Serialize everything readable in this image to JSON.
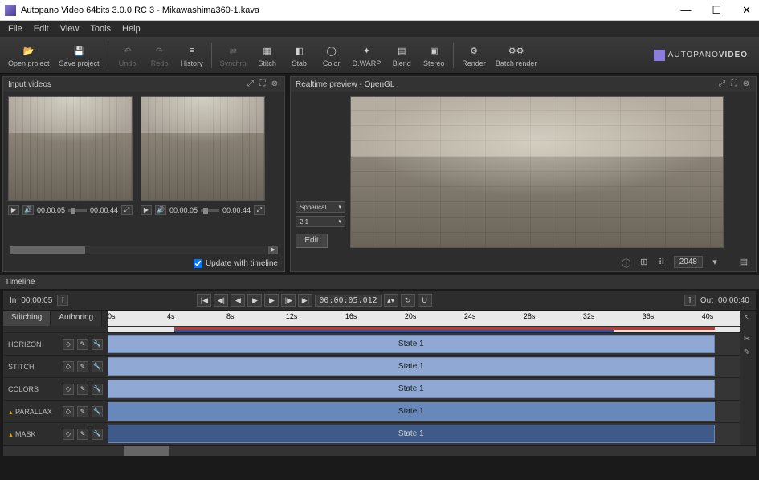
{
  "window": {
    "title": "Autopano Video 64bits 3.0.0 RC 3 - Mikawashima360-1.kava",
    "min": "—",
    "max": "☐",
    "close": "✕"
  },
  "menu": [
    "File",
    "Edit",
    "View",
    "Tools",
    "Help"
  ],
  "toolbar": [
    {
      "id": "open",
      "label": "Open project",
      "glyph": "📂"
    },
    {
      "id": "save",
      "label": "Save project",
      "glyph": "💾"
    },
    {
      "sep": true
    },
    {
      "id": "undo",
      "label": "Undo",
      "glyph": "↶",
      "dis": true
    },
    {
      "id": "redo",
      "label": "Redo",
      "glyph": "↷",
      "dis": true
    },
    {
      "id": "history",
      "label": "History",
      "glyph": "≡"
    },
    {
      "sep": true
    },
    {
      "id": "synchro",
      "label": "Synchro",
      "glyph": "⇄",
      "dis": true
    },
    {
      "id": "stitch",
      "label": "Stitch",
      "glyph": "▦"
    },
    {
      "id": "stab",
      "label": "Stab",
      "glyph": "◧"
    },
    {
      "id": "color",
      "label": "Color",
      "glyph": "◯"
    },
    {
      "id": "dwarp",
      "label": "D.WARP",
      "glyph": "✦"
    },
    {
      "id": "blend",
      "label": "Blend",
      "glyph": "▤"
    },
    {
      "id": "stereo",
      "label": "Stereo",
      "glyph": "▣"
    },
    {
      "sep": true
    },
    {
      "id": "render",
      "label": "Render",
      "glyph": "⚙"
    },
    {
      "id": "batch",
      "label": "Batch render",
      "glyph": "⚙⚙"
    }
  ],
  "brand": {
    "name": "AUTOPANO",
    "suffix": "VIDEO"
  },
  "panels": {
    "input": {
      "title": "Input videos"
    },
    "preview": {
      "title": "Realtime preview - OpenGL"
    }
  },
  "thumbs": [
    {
      "start": "00:00:05",
      "end": "00:00:44"
    },
    {
      "start": "00:00:05",
      "end": "00:00:44"
    }
  ],
  "input_foot": {
    "checkbox": "Update with timeline",
    "checked": true
  },
  "preview_side": {
    "proj": "Spherical",
    "ratio": "2:1",
    "edit": "Edit"
  },
  "preview_foot": {
    "width": "2048"
  },
  "timeline": {
    "title": "Timeline",
    "in_label": "In",
    "in_time": "00:00:05",
    "out_label": "Out",
    "out_time": "00:00:40",
    "timecode": "00:00:05.012",
    "tabs": [
      "Stitching",
      "Authoring"
    ],
    "active_tab": 0,
    "ticks": [
      "0s",
      "4s",
      "8s",
      "12s",
      "16s",
      "20s",
      "24s",
      "28s",
      "32s",
      "36s",
      "40s"
    ],
    "tracks": [
      {
        "name": "HORIZON",
        "state": "State 1",
        "style": "a"
      },
      {
        "name": "STITCH",
        "state": "State 1",
        "style": "a"
      },
      {
        "name": "COLORS",
        "state": "State 1",
        "style": "a"
      },
      {
        "name": "PARALLAX",
        "state": "State 1",
        "style": "b",
        "warn": true
      },
      {
        "name": "MASK",
        "state": "State 1",
        "style": "c",
        "warn": true
      }
    ]
  }
}
